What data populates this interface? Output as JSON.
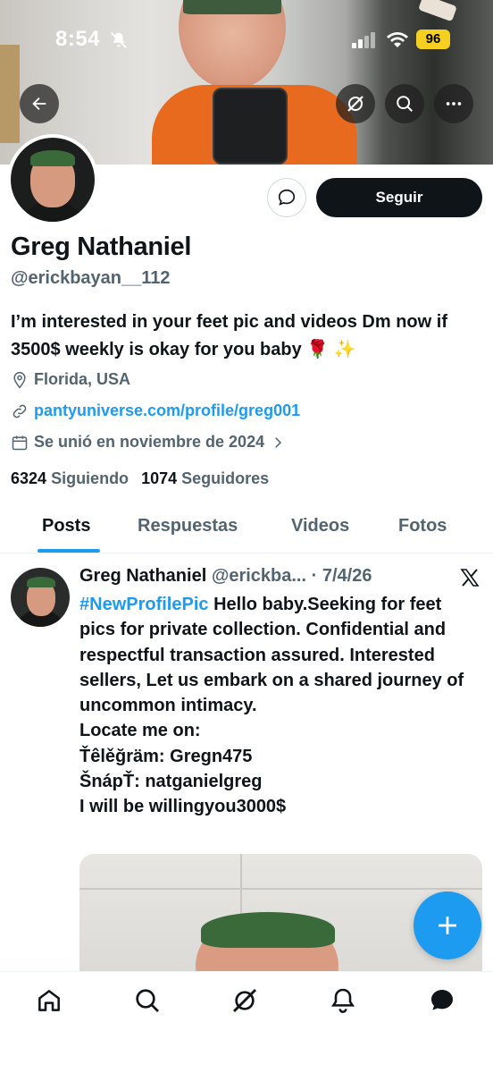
{
  "status_bar": {
    "time": "8:54",
    "battery": "96"
  },
  "profile": {
    "name": "Greg Nathaniel",
    "handle": "@erickbayan__112",
    "bio": "I’m interested in your feet pic and videos Dm now if 3500$ weekly is okay for you baby 🌹 ✨",
    "location": "Florida, USA",
    "website": "pantyuniverse.com/profile/greg001",
    "joined": "Se unió en noviembre de 2024",
    "following_count": "6324",
    "following_label": "Siguiendo",
    "followers_count": "1074",
    "followers_label": "Seguidores",
    "follow_button": "Seguir"
  },
  "tabs": [
    {
      "label": "Posts",
      "active": true
    },
    {
      "label": "Respuestas",
      "active": false
    },
    {
      "label": "Videos",
      "active": false
    },
    {
      "label": "Fotos",
      "active": false
    }
  ],
  "post": {
    "author_name": "Greg Nathaniel",
    "author_handle": "@erickba...",
    "date": "· 7/4/26",
    "hashtag": "#NewProfilePic",
    "text_after_hashtag": " Hello baby.Seeking for feet pics for private collection. Confidential and respectful transaction assured. Interested sellers, Let us embark on a shared journey of uncommon intimacy.",
    "line_locate": "Locate me on:",
    "line_telegram": "Ťêlěğräm: Gregn475",
    "line_snap": "ŠnápŤ: natganielgreg",
    "line_will": "I will be willingyou3000$"
  },
  "colors": {
    "accent": "#1d9bf0",
    "text": "#0f1419",
    "secondary": "#536471"
  },
  "icons": [
    "back-arrow-icon",
    "grok-icon",
    "search-icon",
    "more-icon",
    "message-icon",
    "location-icon",
    "link-icon",
    "calendar-icon",
    "x-logo-icon",
    "plus-icon",
    "home-icon",
    "bell-icon",
    "envelope-icon"
  ]
}
